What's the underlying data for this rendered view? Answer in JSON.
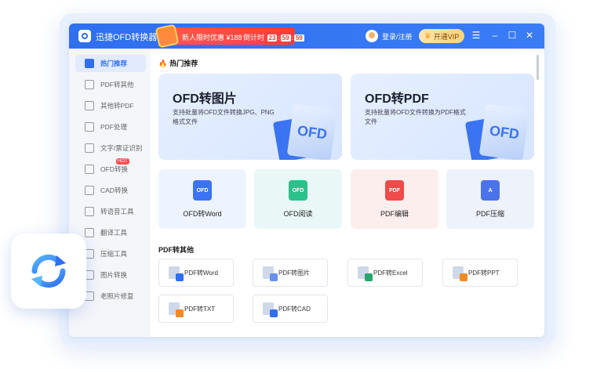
{
  "titlebar": {
    "app_name": "迅捷OFD转换器",
    "promo_text": "新人限时优惠 ¥188",
    "countdown_label": "倒计时",
    "countdown": [
      "23",
      "59",
      "59"
    ],
    "login_label": "登录/注册",
    "vip_label": "开通VIP"
  },
  "sidebar": {
    "items": [
      {
        "label": "热门推荐",
        "active": true
      },
      {
        "label": "PDF转其他"
      },
      {
        "label": "其他转PDF"
      },
      {
        "label": "PDF处理"
      },
      {
        "label": "文字/票证识别"
      },
      {
        "label": "OFD转换",
        "badge": "HOT"
      },
      {
        "label": "CAD转换"
      },
      {
        "label": "转语音工具"
      },
      {
        "label": "翻译工具"
      },
      {
        "label": "压缩工具"
      },
      {
        "label": "图片转换"
      },
      {
        "label": "老照片修复"
      }
    ]
  },
  "main": {
    "hot_title": "热门推荐",
    "big_cards": [
      {
        "title": "OFD转图片",
        "desc": "支持批量将OFD文件转换JPG、PNG格式文件",
        "doc_text": "OFD"
      },
      {
        "title": "OFD转PDF",
        "desc": "支持批量将OFD文件转换为PDF格式文件",
        "doc_text": "OFD"
      }
    ],
    "tools": [
      {
        "label": "OFD转Word",
        "bg": "#eef4ff",
        "icon_color": "#3b74f2",
        "icon_text": "OFD"
      },
      {
        "label": "OFD阅读",
        "bg": "#e9f7f6",
        "icon_color": "#2cc08a",
        "icon_text": "OFD"
      },
      {
        "label": "PDF编辑",
        "bg": "#fdeeee",
        "icon_color": "#ef4b4b",
        "icon_text": "PDF"
      },
      {
        "label": "PDF压缩",
        "bg": "#eef2fb",
        "icon_color": "#4b74e8",
        "icon_text": "A"
      }
    ],
    "pdf_section_title": "PDF转其他",
    "pdf_tools": [
      {
        "label": "PDF转Word",
        "badge_color": "#2f6ff0"
      },
      {
        "label": "PDF转图片",
        "badge_color": "#6a8ff0"
      },
      {
        "label": "PDF转Excel",
        "badge_color": "#22a86b"
      },
      {
        "label": "PDF转PPT",
        "badge_color": "#f08a24"
      },
      {
        "label": "PDF转TXT",
        "badge_color": "#f08a24"
      },
      {
        "label": "PDF转CAD",
        "badge_color": "#2f6ff0"
      }
    ]
  },
  "colors": {
    "accent": "#2f6ff0",
    "promo": "#ff3b3b",
    "vip": "#ffd27a"
  }
}
